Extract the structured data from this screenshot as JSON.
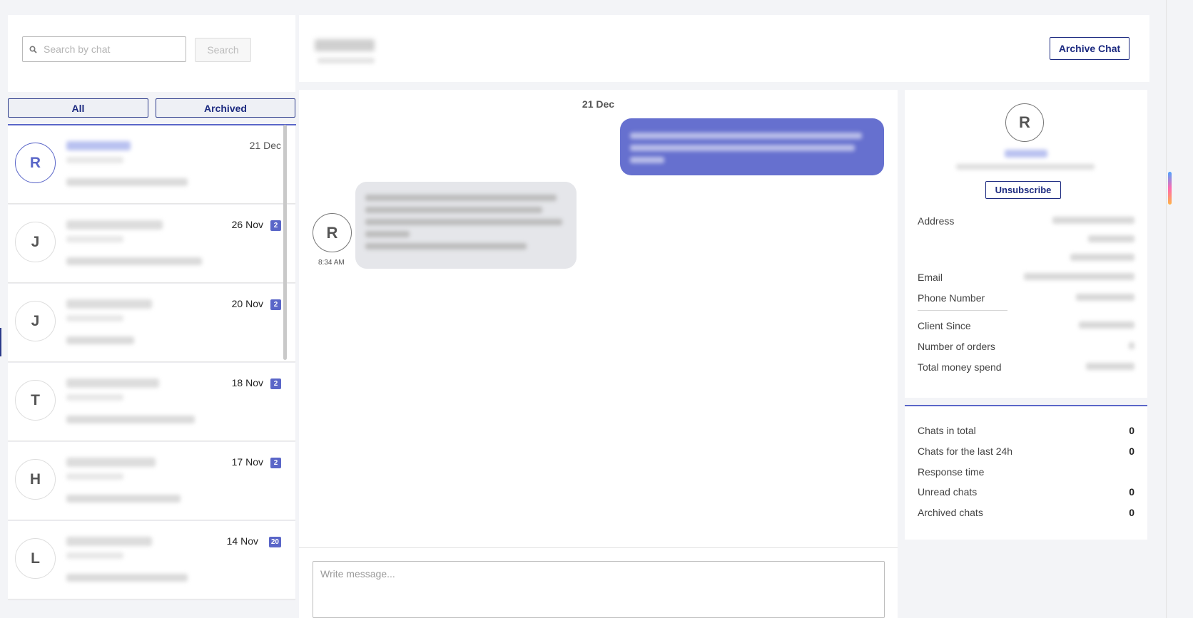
{
  "search": {
    "placeholder": "Search by chat",
    "button_label": "Search"
  },
  "tabs": [
    {
      "label": "All"
    },
    {
      "label": "Archived"
    }
  ],
  "chat_list": [
    {
      "avatar_letter": "R",
      "date": "21 Dec",
      "badge": "",
      "active": true
    },
    {
      "avatar_letter": "J",
      "date": "26 Nov",
      "badge": "2",
      "active": false
    },
    {
      "avatar_letter": "J",
      "date": "20 Nov",
      "badge": "2",
      "active": false
    },
    {
      "avatar_letter": "T",
      "date": "18 Nov",
      "badge": "2",
      "active": false
    },
    {
      "avatar_letter": "H",
      "date": "17 Nov",
      "badge": "2",
      "active": false
    },
    {
      "avatar_letter": "L",
      "date": "14 Nov",
      "badge": "20",
      "active": false
    }
  ],
  "header": {
    "archive_button": "Archive Chat"
  },
  "conversation": {
    "day_label": "21 Dec",
    "incoming_avatar": "R",
    "incoming_time": "8:34 AM",
    "compose_placeholder": "Write message..."
  },
  "profile": {
    "avatar_letter": "R",
    "unsubscribe_label": "Unsubscribe",
    "fields": {
      "address": "Address",
      "email": "Email",
      "phone": "Phone Number",
      "client_since": "Client Since",
      "orders": "Number of orders",
      "money": "Total money spend"
    }
  },
  "stats": {
    "chats_total": {
      "label": "Chats in total",
      "value": "0"
    },
    "chats_24h": {
      "label": "Chats for the last 24h",
      "value": "0"
    },
    "response_time": {
      "label": "Response time",
      "value": ""
    },
    "unread": {
      "label": "Unread chats",
      "value": "0"
    },
    "archived": {
      "label": "Archived chats",
      "value": "0"
    }
  },
  "colors": {
    "accent": "#5a66c8",
    "navy": "#1c2a80",
    "outgoing_bubble": "#6670cf",
    "incoming_bubble": "#e5e6ea"
  },
  "icons": {
    "search": "search-icon"
  }
}
